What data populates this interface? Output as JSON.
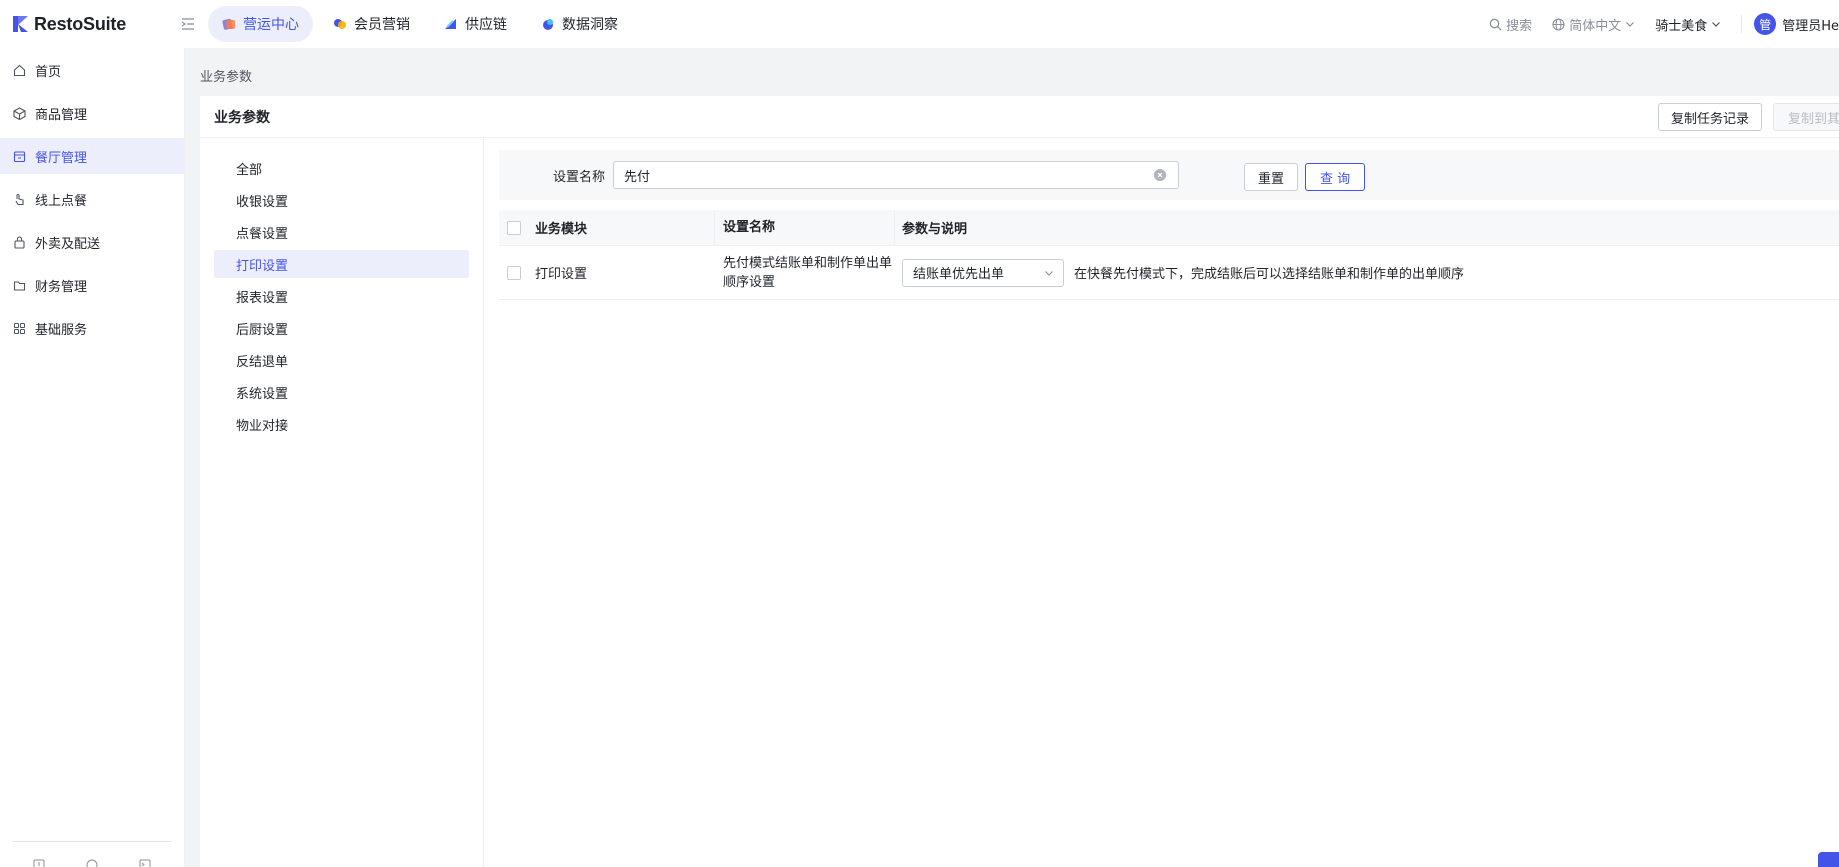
{
  "app": {
    "logo_text": "RestoSuite",
    "brand_color": "#4554e8"
  },
  "top_nav": [
    {
      "label": "营运中心",
      "active": true,
      "icon": "operations-icon"
    },
    {
      "label": "会员营销",
      "active": false,
      "icon": "member-icon"
    },
    {
      "label": "供应链",
      "active": false,
      "icon": "supply-chain-icon"
    },
    {
      "label": "数据洞察",
      "active": false,
      "icon": "data-icon"
    }
  ],
  "top_right": {
    "search_label": "搜索",
    "language": "简体中文",
    "store": "骑士美食",
    "avatar_char": "管",
    "user_name": "管理员He"
  },
  "sidebar": {
    "items": [
      {
        "label": "首页",
        "icon": "home-icon"
      },
      {
        "label": "商品管理",
        "icon": "product-icon"
      },
      {
        "label": "餐厅管理",
        "icon": "store-icon",
        "active": true
      },
      {
        "label": "线上点餐",
        "icon": "online-order-icon"
      },
      {
        "label": "外卖及配送",
        "icon": "delivery-icon"
      },
      {
        "label": "财务管理",
        "icon": "finance-icon"
      },
      {
        "label": "基础服务",
        "icon": "grid-icon"
      }
    ]
  },
  "breadcrumb": "业务参数",
  "card": {
    "title": "业务参数",
    "copy_task_btn": "复制任务记录",
    "copy_to_btn": "复制到其他"
  },
  "categories": [
    {
      "label": "全部"
    },
    {
      "label": "收银设置"
    },
    {
      "label": "点餐设置"
    },
    {
      "label": "打印设置",
      "active": true
    },
    {
      "label": "报表设置"
    },
    {
      "label": "后厨设置"
    },
    {
      "label": "反结退单"
    },
    {
      "label": "系统设置"
    },
    {
      "label": "物业对接"
    }
  ],
  "filter": {
    "label": "设置名称",
    "value": "先付",
    "reset_btn": "重置",
    "query_btn": "查 询"
  },
  "table": {
    "headers": {
      "module": "业务模块",
      "name": "设置名称",
      "param": "参数与说明"
    },
    "rows": [
      {
        "module": "打印设置",
        "name": "先付模式结账单和制作单出单顺序设置",
        "select_value": "结账单优先出单",
        "description": "在快餐先付模式下，完成结账后可以选择结账单和制作单的出单顺序"
      }
    ]
  }
}
